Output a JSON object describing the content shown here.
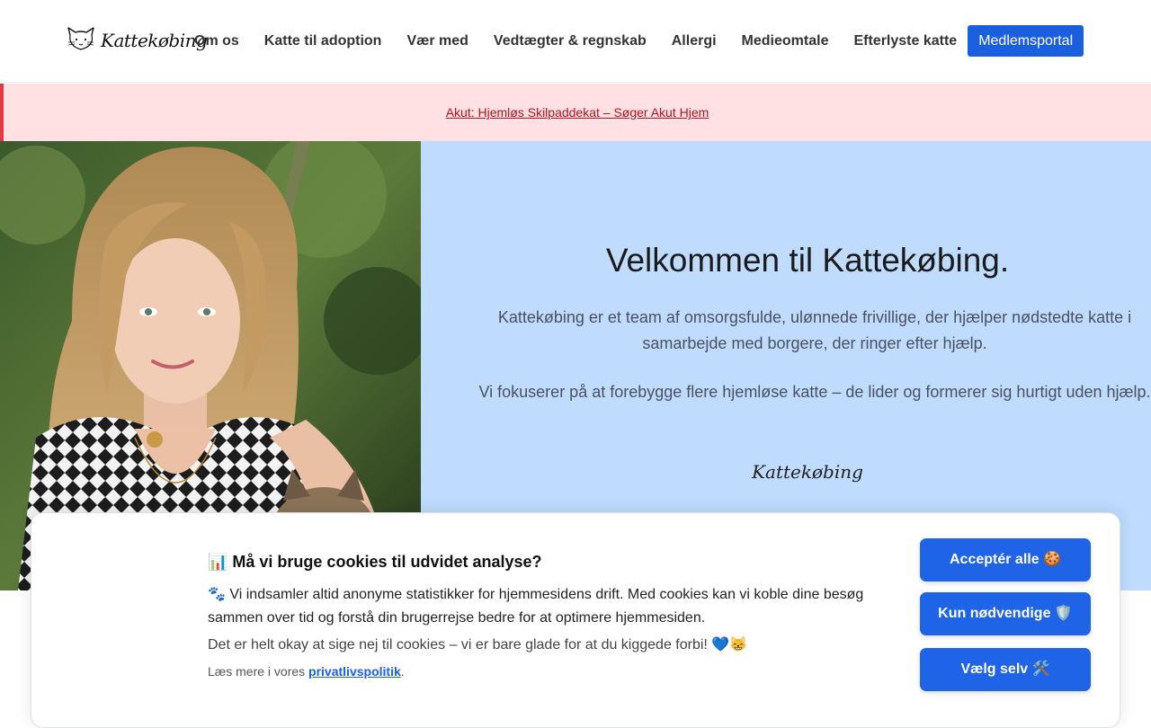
{
  "header": {
    "logo_text": "Kattekøbing",
    "nav": [
      {
        "label": "Om os"
      },
      {
        "label": "Katte til adoption"
      },
      {
        "label": "Vær med"
      },
      {
        "label": "Vedtægter & regnskab"
      },
      {
        "label": "Allergi"
      },
      {
        "label": "Medieomtale"
      },
      {
        "label": "Efterlyste katte"
      }
    ],
    "cta_label": "Medlemsportal"
  },
  "alert": {
    "link_text": "Akut: Hjemløs Skilpaddekat – Søger Akut Hjem"
  },
  "hero": {
    "title": "Velkommen til Kattekøbing.",
    "paragraph1": "Kattekøbing er et team af omsorgsfulde, ulønnede frivillige, der hjælper nødstedte katte i samarbejde med borgere, der ringer efter hjælp.",
    "paragraph2": "Vi fokuserer på at forebygge flere hjemløse katte – de lider og formerer sig hurtigt uden hjælp.",
    "signature": "Kattekøbing"
  },
  "cookie": {
    "title": "📊 Må vi bruge cookies til udvidet analyse?",
    "text1": "🐾 Vi indsamler altid anonyme statistikker for hjemmesidens drift. Med cookies kan vi koble dine besøg sammen over tid og forstå din brugerrejse bedre for at optimere hjemmesiden.",
    "text2": "Det er helt okay at sige nej til cookies – vi er bare glade for at du kiggede forbi! 💙😸",
    "more_prefix": "Læs mere i vores ",
    "more_link": "privatlivspolitik",
    "more_suffix": ".",
    "buttons": {
      "accept_all": "Acceptér alle 🍪",
      "necessary": "Kun nødvendige 🛡️",
      "choose": "Vælg selv 🛠️"
    }
  },
  "colors": {
    "accent": "#1f63e6",
    "alert_bg": "#ffe0e3",
    "alert_border": "#e53945",
    "hero_panel": "#bfdbfe"
  }
}
